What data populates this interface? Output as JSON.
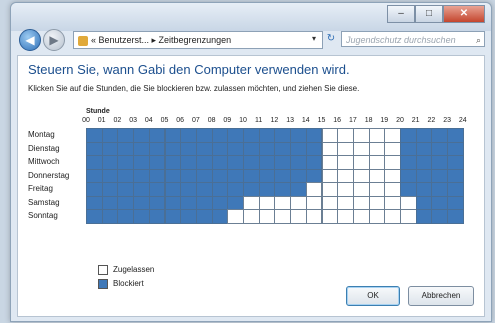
{
  "window": {
    "minimize": "–",
    "maximize": "□",
    "close": "✕"
  },
  "nav": {
    "back": "◀",
    "forward": "▶",
    "address": "« Benutzerst... ▸ Zeitbegrenzungen",
    "address_dropdown": "▾",
    "refresh": "↻",
    "search_placeholder": "Jugendschutz durchsuchen",
    "search_icon": "search-icon"
  },
  "main": {
    "heading": "Steuern Sie, wann Gabi den Computer verwenden wird.",
    "instruction": "Klicken Sie auf die Stunden, die Sie blockieren bzw. zulassen möchten, und ziehen Sie diese.",
    "hours_label": "Stunde",
    "hours": [
      "00",
      "01",
      "02",
      "03",
      "04",
      "05",
      "06",
      "07",
      "08",
      "09",
      "10",
      "11",
      "12",
      "13",
      "14",
      "15",
      "16",
      "17",
      "18",
      "19",
      "20",
      "21",
      "22",
      "23",
      "24"
    ],
    "days": [
      "Montag",
      "Dienstag",
      "Mittwoch",
      "Donnerstag",
      "Freitag",
      "Samstag",
      "Sonntag"
    ],
    "allowed_ranges": [
      [
        15,
        20
      ],
      [
        15,
        20
      ],
      [
        15,
        20
      ],
      [
        15,
        20
      ],
      [
        14,
        20
      ],
      [
        10,
        21
      ],
      [
        9,
        21
      ]
    ]
  },
  "legend": {
    "allowed": "Zugelassen",
    "blocked": "Blockiert"
  },
  "buttons": {
    "ok": "OK",
    "cancel": "Abbrechen"
  },
  "colors": {
    "blocked": "#3f78b8",
    "allowed": "#ffffff",
    "heading": "#1c4f8e"
  }
}
